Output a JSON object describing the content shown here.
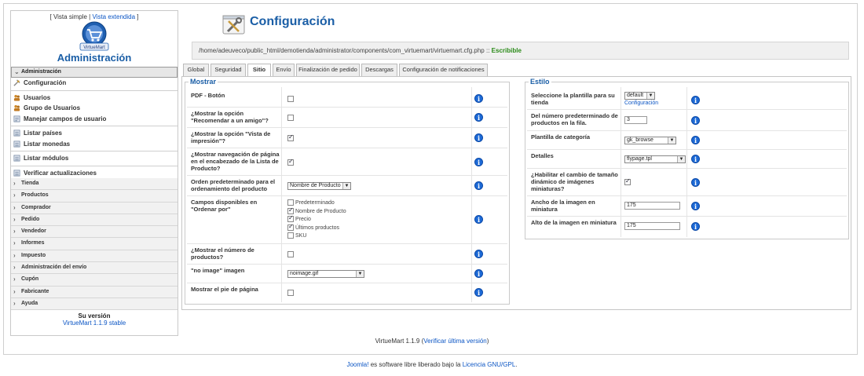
{
  "sidebar": {
    "view_simple": "Vista simple",
    "view_sep": "|",
    "view_extended": "Vista extendida",
    "bracket_open": "[",
    "bracket_close": "]",
    "logo_text": "VirtueMart",
    "admin_title": "Administración",
    "section_header": "Administración",
    "menu": [
      {
        "label": "Configuración",
        "icon": "wrench-icon"
      },
      {
        "label": "Usuarios",
        "icon": "users-icon"
      },
      {
        "label": "Grupo de Usuarios",
        "icon": "user-group-icon"
      },
      {
        "label": "Manejar campos de usuario",
        "icon": "form-icon"
      },
      {
        "label": "Listar países",
        "icon": "list-icon"
      },
      {
        "label": "Listar monedas",
        "icon": "list-icon"
      },
      {
        "label": "Listar módulos",
        "icon": "list-icon"
      },
      {
        "label": "Verificar actualizaciones",
        "icon": "list-icon"
      }
    ],
    "categories": [
      "Tienda",
      "Productos",
      "Comprador",
      "Pedido",
      "Vendedor",
      "Informes",
      "Impuesto",
      "Administración del envío",
      "Cupón",
      "Fabricante",
      "Ayuda"
    ],
    "version_title": "Su versión",
    "version_value": "VirtueMart 1.1.9 stable"
  },
  "header": {
    "title": "Configuración",
    "path": "/home/adeuveco/public_html/demotienda/administrator/components/com_virtuemart/virtuemart.cfg.php",
    "path_sep": "::",
    "path_status": "Escribible"
  },
  "tabs": [
    "Global",
    "Seguridad",
    "Sitio",
    "Envío",
    "Finalización de pedido",
    "Descargas",
    "Configuración de notificaciones"
  ],
  "mostrar": {
    "legend": "Mostrar",
    "rows": [
      {
        "label": "PDF - Botón",
        "checked": false
      },
      {
        "label": "¿Mostrar la opción \"Recomendar a un amigo\"?",
        "checked": false
      },
      {
        "label": "¿Mostrar la opción \"Vista de impresión\"?",
        "checked": true
      },
      {
        "label": "¿Mostrar navegación de página en el encabezado de la Lista de Producto?",
        "checked": true
      },
      {
        "label": "Orden predeterminado para el ordenamiento del producto",
        "select": "Nombre de Producto"
      },
      {
        "label": "Campos disponibles en \"Ordenar por\""
      },
      {
        "label": "¿Mostrar el número de productos?",
        "checked": false
      },
      {
        "label": "\"no image\" imagen",
        "select": "noimage.gif"
      },
      {
        "label": "Mostrar el pie de página",
        "checked": false
      }
    ],
    "order_fields": [
      {
        "label": "Predeterminado",
        "checked": false
      },
      {
        "label": "Nombre de Producto",
        "checked": true
      },
      {
        "label": "Precio",
        "checked": true
      },
      {
        "label": "Últimos productos",
        "checked": true
      },
      {
        "label": "SKU",
        "checked": false
      }
    ]
  },
  "estilo": {
    "legend": "Estilo",
    "rows": [
      {
        "label": "Seleccione la plantilla para su tienda",
        "select": "default",
        "link": "Configuración"
      },
      {
        "label": "Del número predeterminado de productos en la fila.",
        "input": "3"
      },
      {
        "label": "Plantilla de categoría",
        "select": "gk_browse"
      },
      {
        "label": "Detalles",
        "select": "flypage.tpl"
      },
      {
        "label": "¿Habilitar el cambio de tamaño dinámico de imágenes miniaturas?",
        "checked": true
      },
      {
        "label": "Ancho de la imagen en miniatura",
        "input": "175"
      },
      {
        "label": "Alto de la imagen en miniatura",
        "input": "175"
      }
    ]
  },
  "info_icon": "i",
  "footer": {
    "vm_version": "VirtueMart 1.1.9",
    "paren_open": "(",
    "verify_link": "Verificar última versión",
    "paren_close": ")",
    "joomla": "Joomla!",
    "joomla_text": "es software libre liberado bajo la",
    "license_link": "Licencia GNU/GPL",
    "period": "."
  },
  "colors": {
    "accent": "#1a5ea6",
    "link": "#0b55c4",
    "status_ok": "#2a8a18",
    "info": "#1d6ad6"
  }
}
